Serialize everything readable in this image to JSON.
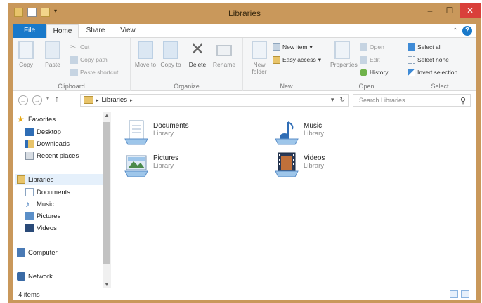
{
  "window": {
    "title": "Libraries",
    "min_glyph": "–",
    "max_glyph": "☐",
    "close_glyph": "✕"
  },
  "ribbon_tabs": {
    "file": "File",
    "home": "Home",
    "share": "Share",
    "view": "View"
  },
  "ribbon": {
    "clipboard": {
      "copy": "Copy",
      "paste": "Paste",
      "cut": "Cut",
      "copy_path": "Copy path",
      "paste_shortcut": "Paste shortcut",
      "label": "Clipboard"
    },
    "organize": {
      "move_to": "Move to",
      "copy_to": "Copy to",
      "delete": "Delete",
      "rename": "Rename",
      "label": "Organize"
    },
    "new": {
      "new_folder": "New folder",
      "new_item": "New item",
      "easy_access": "Easy access",
      "label": "New"
    },
    "open": {
      "properties": "Properties",
      "open": "Open",
      "edit": "Edit",
      "history": "History",
      "label": "Open"
    },
    "select": {
      "select_all": "Select all",
      "select_none": "Select none",
      "invert_selection": "Invert selection",
      "label": "Select"
    }
  },
  "address": {
    "path": "Libraries",
    "search_placeholder": "Search Libraries"
  },
  "nav": {
    "favorites": "Favorites",
    "desktop": "Desktop",
    "downloads": "Downloads",
    "recent": "Recent places",
    "libraries": "Libraries",
    "documents": "Documents",
    "music": "Music",
    "pictures": "Pictures",
    "videos": "Videos",
    "computer": "Computer",
    "network": "Network"
  },
  "libraries": [
    {
      "name": "Documents",
      "type": "Library"
    },
    {
      "name": "Music",
      "type": "Library"
    },
    {
      "name": "Pictures",
      "type": "Library"
    },
    {
      "name": "Videos",
      "type": "Library"
    }
  ],
  "status": {
    "count": "4 items"
  },
  "colors": {
    "title_bar": "#c9985b",
    "file_tab": "#1979ca",
    "close": "#d9403a"
  }
}
